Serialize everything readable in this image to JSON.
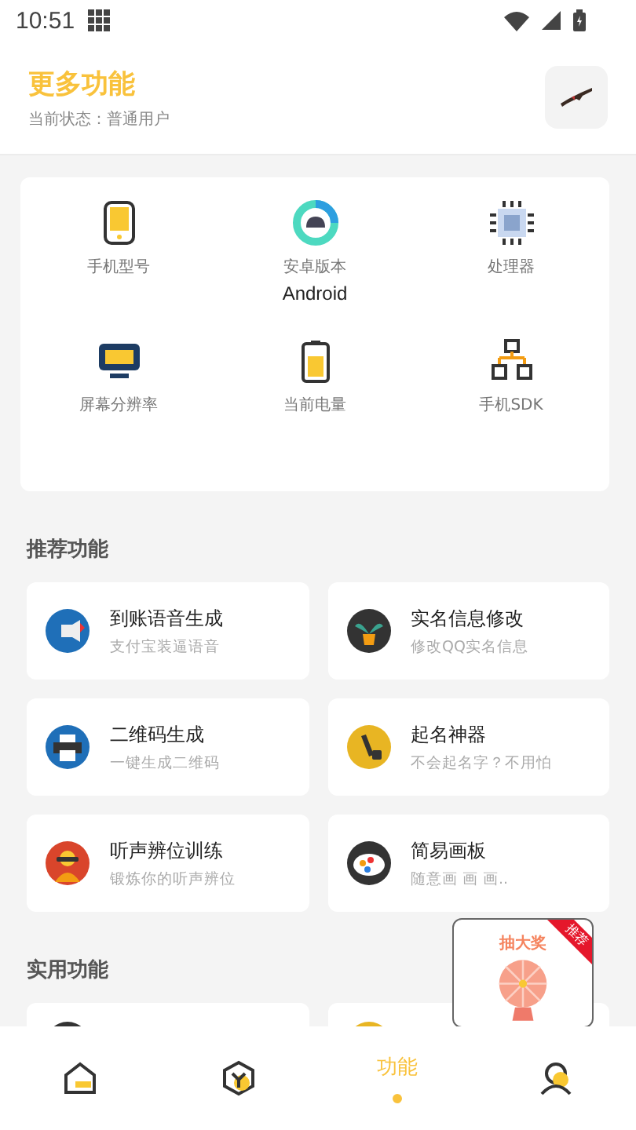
{
  "status_bar": {
    "time": "10:51"
  },
  "header": {
    "title": "更多功能",
    "status": "当前状态：普通用户"
  },
  "device_info": [
    {
      "kind": "phone",
      "label": "手机型号"
    },
    {
      "kind": "android",
      "label": "安卓版本",
      "value": "Android"
    },
    {
      "kind": "cpu",
      "label": "处理器"
    },
    {
      "kind": "screen",
      "label": "屏幕分辨率"
    },
    {
      "kind": "battery",
      "label": "当前电量"
    },
    {
      "kind": "sdk",
      "label": "手机SDK"
    }
  ],
  "recommended": {
    "title": "推荐功能",
    "items": [
      {
        "kind": "speaker",
        "title": "到账语音生成",
        "subtitle": "支付宝装逼语音"
      },
      {
        "kind": "plant",
        "title": "实名信息修改",
        "subtitle": "修改QQ实名信息"
      },
      {
        "kind": "printer",
        "title": "二维码生成",
        "subtitle": "一键生成二维码"
      },
      {
        "kind": "pen",
        "title": "起名神器",
        "subtitle": "不会起名字？不用怕"
      },
      {
        "kind": "person",
        "title": "听声辨位训练",
        "subtitle": "锻炼你的听声辨位"
      },
      {
        "kind": "palette",
        "title": "简易画板",
        "subtitle": "随意画 画 画.."
      }
    ]
  },
  "practical": {
    "title": "实用功能",
    "items": [
      {
        "kind": "dark"
      },
      {
        "kind": "gold"
      }
    ]
  },
  "promo": {
    "title": "抽大奖",
    "badge": "推荐"
  },
  "bottom_nav": [
    {
      "kind": "home",
      "selected": false
    },
    {
      "kind": "cube",
      "selected": false
    },
    {
      "kind": "text",
      "label": "功能",
      "selected": true
    },
    {
      "kind": "person",
      "selected": false
    }
  ]
}
